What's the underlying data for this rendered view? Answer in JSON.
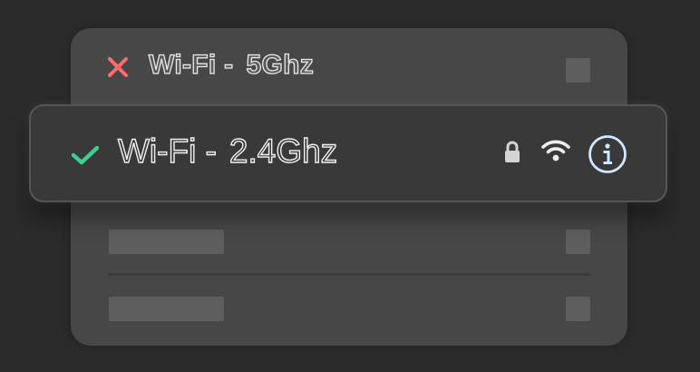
{
  "networks": [
    {
      "label_prefix": "Wi-Fi -",
      "ssid": "5Ghz",
      "status_icon": "x-icon",
      "status": "disconnected",
      "status_color": "#ff6b6b"
    },
    {
      "label_prefix": "Wi-Fi -",
      "ssid": "2.4Ghz",
      "status_icon": "checkmark-icon",
      "status": "connected",
      "status_color": "#3ecf8e",
      "secured_icon": "lock-icon",
      "signal_icon": "wifi-signal-icon",
      "info_icon": "info-icon",
      "info_color": "#cfe8ff"
    }
  ],
  "colors": {
    "background": "#2b2b2b",
    "panel": "#474747",
    "active_card": "#393939",
    "placeholder": "#5e5e5e"
  }
}
